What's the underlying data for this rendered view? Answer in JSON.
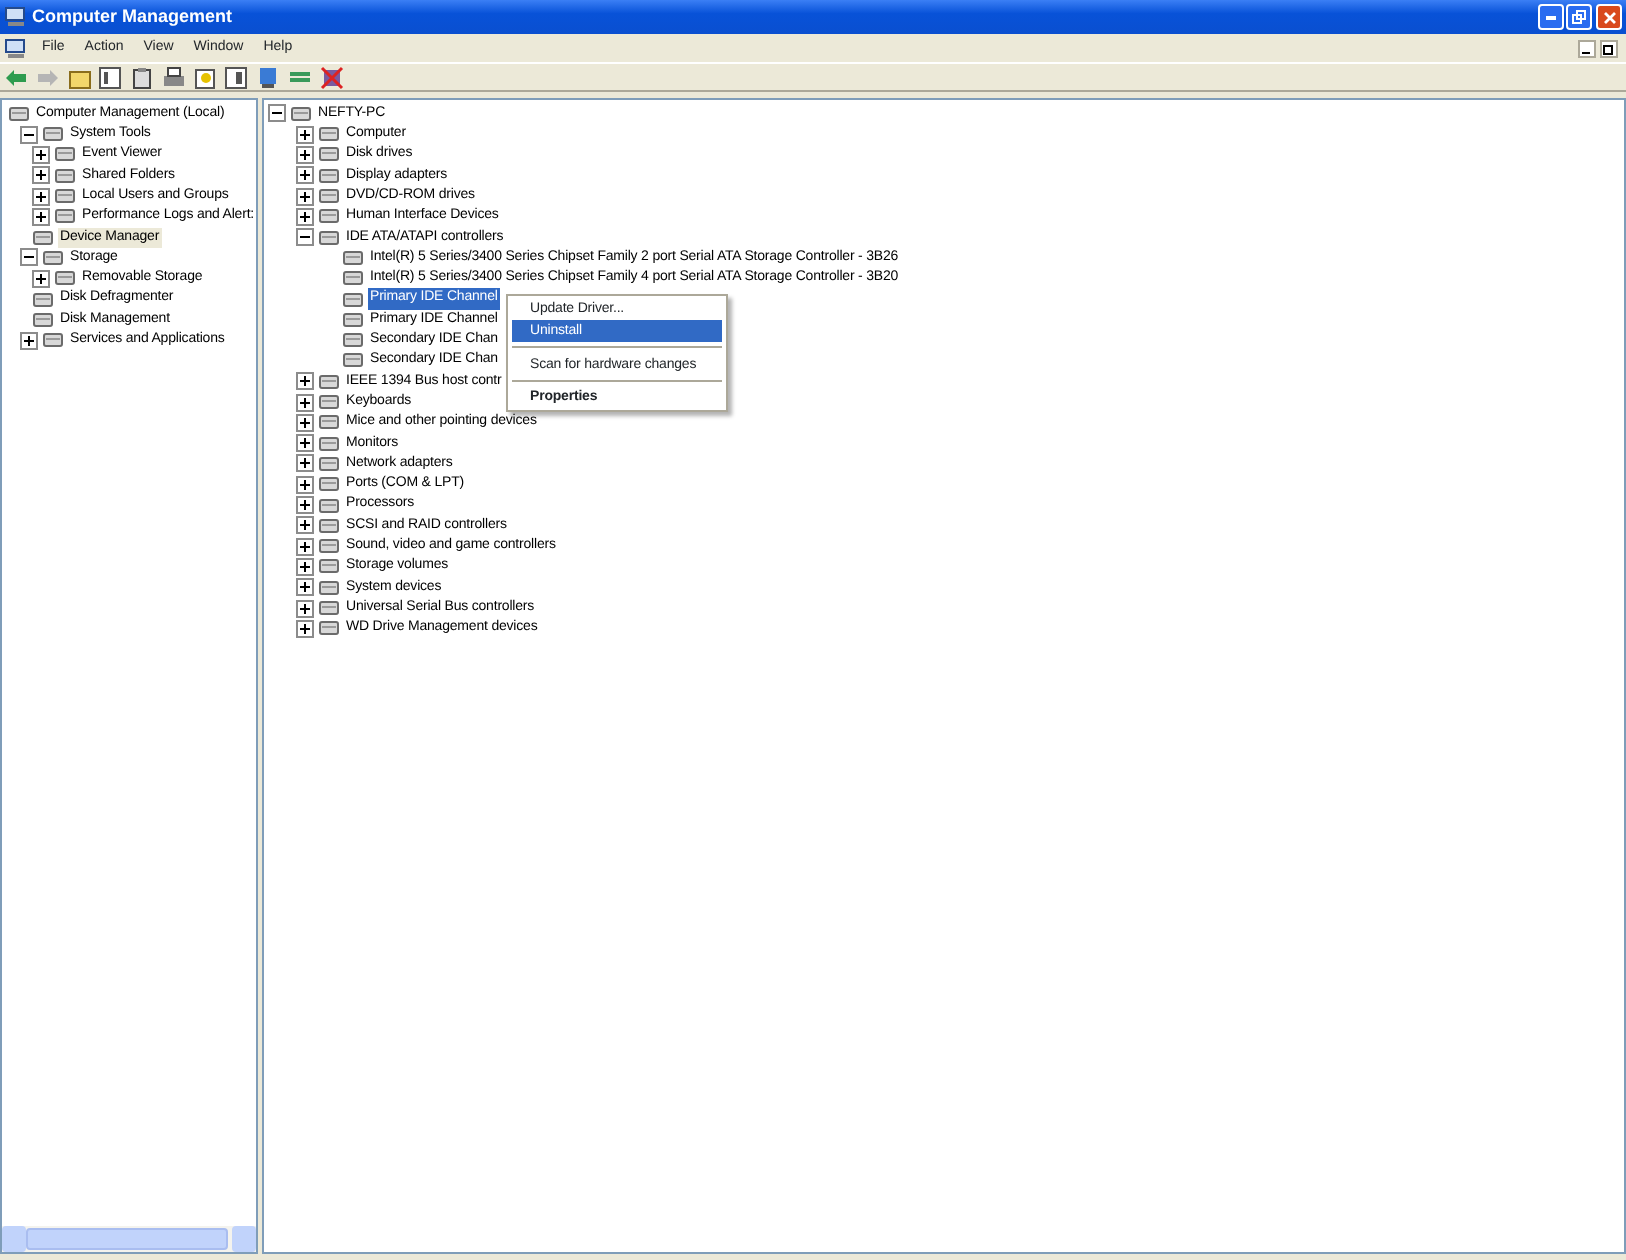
{
  "window": {
    "title": "Computer Management"
  },
  "menu": [
    "File",
    "Action",
    "View",
    "Window",
    "Help"
  ],
  "left_tree": [
    {
      "label": "Computer Management (Local)",
      "selected": false,
      "children": [
        {
          "label": "System Tools",
          "selected": false,
          "expanded": true,
          "children": [
            {
              "label": "Event Viewer",
              "selected": false,
              "expanded": false
            },
            {
              "label": "Shared Folders",
              "selected": false,
              "expanded": false
            },
            {
              "label": "Local Users and Groups",
              "selected": false,
              "expanded": false
            },
            {
              "label": "Performance Logs and Alert:",
              "selected": false,
              "expanded": false
            },
            {
              "label": "Device Manager",
              "selected": true
            }
          ]
        },
        {
          "label": "Storage",
          "selected": false,
          "expanded": true,
          "children": [
            {
              "label": "Removable Storage",
              "selected": false,
              "expanded": false
            },
            {
              "label": "Disk Defragmenter",
              "selected": false
            },
            {
              "label": "Disk Management",
              "selected": false
            }
          ]
        },
        {
          "label": "Services and Applications",
          "selected": false,
          "expanded": false
        }
      ]
    }
  ],
  "device_tree": [
    {
      "label": "NEFTY-PC",
      "selected": false,
      "expanded": true,
      "children": [
        {
          "label": "Computer",
          "selected": false,
          "expanded": false
        },
        {
          "label": "Disk drives",
          "selected": false,
          "expanded": false
        },
        {
          "label": "Display adapters",
          "selected": false,
          "expanded": false
        },
        {
          "label": "DVD/CD-ROM drives",
          "selected": false,
          "expanded": false
        },
        {
          "label": "Human Interface Devices",
          "selected": false,
          "expanded": false
        },
        {
          "label": "IDE ATA/ATAPI controllers",
          "selected": false,
          "expanded": true,
          "children": [
            {
              "label": "Intel(R) 5 Series/3400 Series Chipset Family 2 port Serial ATA Storage Controller - 3B26",
              "selected": false
            },
            {
              "label": "Intel(R) 5 Series/3400 Series Chipset Family 4 port Serial ATA Storage Controller - 3B20",
              "selected": false
            },
            {
              "label": "Primary IDE Channel",
              "selected": true
            },
            {
              "label": "Primary IDE Channel",
              "selected": false
            },
            {
              "label": "Secondary IDE Chan",
              "selected": false
            },
            {
              "label": "Secondary IDE Chan",
              "selected": false
            }
          ]
        },
        {
          "label": "IEEE 1394 Bus host contr",
          "selected": false,
          "expanded": false
        },
        {
          "label": "Keyboards",
          "selected": false,
          "expanded": false
        },
        {
          "label": "Mice and other pointing devices",
          "selected": false,
          "expanded": false
        },
        {
          "label": "Monitors",
          "selected": false,
          "expanded": false
        },
        {
          "label": "Network adapters",
          "selected": false,
          "expanded": false
        },
        {
          "label": "Ports (COM & LPT)",
          "selected": false,
          "expanded": false
        },
        {
          "label": "Processors",
          "selected": false,
          "expanded": false
        },
        {
          "label": "SCSI and RAID controllers",
          "selected": false,
          "expanded": false
        },
        {
          "label": "Sound, video and game controllers",
          "selected": false,
          "expanded": false
        },
        {
          "label": "Storage volumes",
          "selected": false,
          "expanded": false
        },
        {
          "label": "System devices",
          "selected": false,
          "expanded": false
        },
        {
          "label": "Universal Serial Bus controllers",
          "selected": false,
          "expanded": false
        },
        {
          "label": "WD Drive Management devices",
          "selected": false,
          "expanded": false
        }
      ]
    }
  ],
  "context_menu": [
    {
      "kind": "item",
      "label": "Update Driver...",
      "selected": false
    },
    {
      "kind": "item",
      "label": "Uninstall",
      "selected": true
    },
    {
      "kind": "separator"
    },
    {
      "kind": "item",
      "label": "Scan for hardware changes",
      "selected": false
    },
    {
      "kind": "separator"
    },
    {
      "kind": "default",
      "label": "Properties",
      "selected": false
    }
  ]
}
